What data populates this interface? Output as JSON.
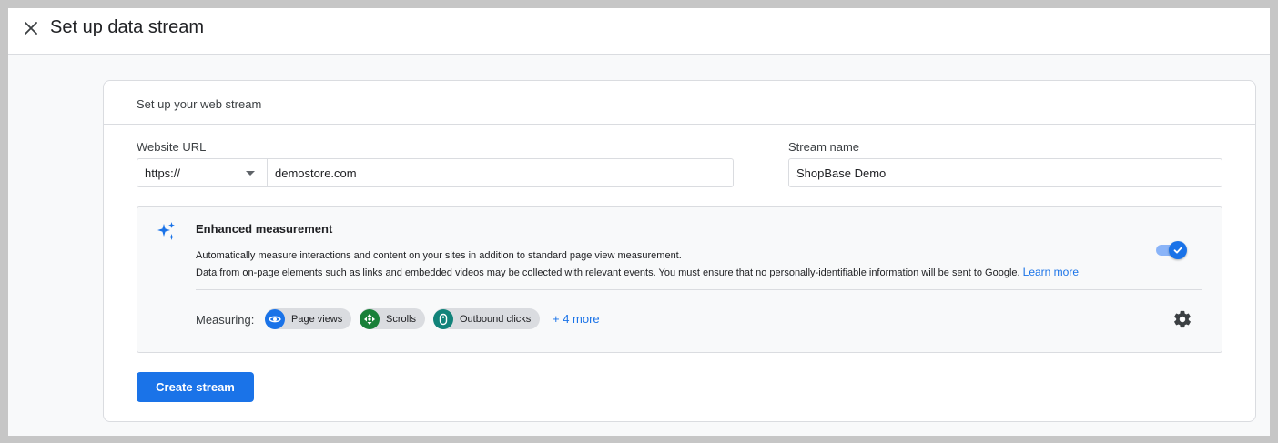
{
  "header": {
    "title": "Set up data stream",
    "close_icon": "close-icon"
  },
  "card": {
    "header": "Set up your web stream",
    "website_url": {
      "label": "Website URL",
      "protocol": "https://",
      "value": "demostore.com"
    },
    "stream_name": {
      "label": "Stream name",
      "value": "ShopBase Demo"
    },
    "enhanced_measurement": {
      "title": "Enhanced measurement",
      "description": "Automatically measure interactions and content on your sites in addition to standard page view measurement.",
      "note": "Data from on-page elements such as links and embedded videos may be collected with relevant events. You must ensure that no personally-identifiable information will be sent to Google.",
      "learn_more": "Learn more",
      "enabled": true,
      "measuring_label": "Measuring:",
      "chips": [
        {
          "label": "Page views",
          "icon": "eye-icon",
          "color": "#1a73e8"
        },
        {
          "label": "Scrolls",
          "icon": "scroll-icon",
          "color": "#188038"
        },
        {
          "label": "Outbound clicks",
          "icon": "mouse-icon",
          "color": "#12837a"
        }
      ],
      "more": "+ 4 more",
      "settings_icon": "gear-icon"
    },
    "create_button": "Create stream"
  },
  "colors": {
    "accent": "#1a73e8",
    "toggle_track": "#8ab4f8"
  }
}
